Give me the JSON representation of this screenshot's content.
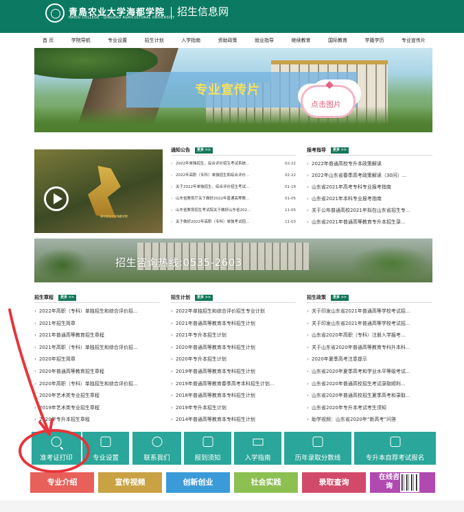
{
  "header": {
    "logo_cn": "青島农业大学海都学院",
    "logo_en": "HAIDU COLLEGE · QINGDAO AGRICULTURAL UNIVERSITY",
    "site_title": "招生信息网",
    "bg_color": "#0c7a62"
  },
  "nav": [
    "首 页",
    "学院导航",
    "专业设置",
    "招生计划",
    "入学指南",
    "资助政策",
    "就业指导",
    "继续教育",
    "国际教育",
    "学籍学历",
    "专业宣传片"
  ],
  "hero": {
    "banner": "专业宣传片",
    "cloud": "点击图片"
  },
  "video": {
    "caption": "青岛农业大学海都学院"
  },
  "more_label": "更多 >>",
  "notices": {
    "title": "通知公告",
    "items": [
      {
        "text": "2022年单独招生、综合评价招生考试系统...",
        "date": "02-22"
      },
      {
        "text": "2022年高职（专科）单独招生和综合评价...",
        "date": "02-22"
      },
      {
        "text": "关于2022年单独招生、综合评价招生考试...",
        "date": "01-18"
      },
      {
        "text": "山东省教育厅关于做好2022年普通高等教...",
        "date": "01-05"
      },
      {
        "text": "山东省教育招生考试院关于做好山东省202...",
        "date": "11-05"
      },
      {
        "text": "关于做好2022年高职（专科）单独考试招...",
        "date": "11-03"
      }
    ]
  },
  "guide": {
    "title": "报考指导",
    "items": [
      "2022年普通高校专升本政策解读",
      "2022年山东省春季高考政策解读（30问）...",
      "山东省2021年高考专科专业报考指南",
      "山东省2021年本科专业报考指南",
      "关于公布普通高校2021年拟在山东省招生专...",
      "山东省2021年普通高等教育专升本招生录..."
    ]
  },
  "hotline": "招生咨询热线:0535-2603",
  "charter": {
    "title": "招生章程",
    "items": [
      "2022年高职（专科）单独招生和综合评价招...",
      "2021年招生简章",
      "2021年普通高等教育招生章程",
      "2021年高职（专科）单独招生和综合评价招...",
      "2020年招生简章",
      "2020年普通高等教育招生章程",
      "2020年高职（专科）单独招生和综合评价招...",
      "2020年艺术类专业招生章程",
      "2019年艺术类专业招生章程",
      "2020年专升本招生章程"
    ]
  },
  "plan": {
    "title": "招生计划",
    "items": [
      "2022年单独招生和综合评价招生专业计划",
      "2021年普通高等教育本专科招生计划",
      "2021年专升本招生计划",
      "2020年普通高等教育本专科招生计划",
      "2020年专升本招生计划",
      "2019年普通高等教育本专科招生计划",
      "2019年普通高等教育春季高考本科招生计划...",
      "2018年普通高等教育本专科招生计划",
      "2019年专升本招生计划",
      "2014年普通高等教育本专科招生计划"
    ]
  },
  "policy": {
    "title": "招生政策",
    "items": [
      "关于印发山东省2021年普通高等学校考试招...",
      "关于印发山东省2021年普通高等学校考试招...",
      "山东省2020年高职（专科）注册入学报考...",
      "关于山东省2020年普通高等教育专科升本科...",
      "2020年夏季高考注意提示",
      "山东省2020年夏季高考和学业水平等级考试...",
      "山东省2020年普通高校招生考试录取顺利...",
      "山东省2020年普通高校招生夏季高考和录取...",
      "山东省2020年专升本考试考生须知",
      "助学视频：山东省2020年“新高考”问答"
    ]
  },
  "services": [
    "准考证打印",
    "专业设置",
    "联系我们",
    "报到须知",
    "入学指南",
    "历年录取分数线",
    "专升本自荐考试报名"
  ],
  "tiles": [
    {
      "label": "专业介绍",
      "color": "#e8605a"
    },
    {
      "label": "宣传视频",
      "color": "#c9a244"
    },
    {
      "label": "创新创业",
      "color": "#3b9bd8"
    },
    {
      "label": "社会实践",
      "color": "#8dc052"
    },
    {
      "label": "录取查询",
      "color": "#d24a6a"
    },
    {
      "label": "在线咨询",
      "color": "#b04ab0"
    }
  ]
}
